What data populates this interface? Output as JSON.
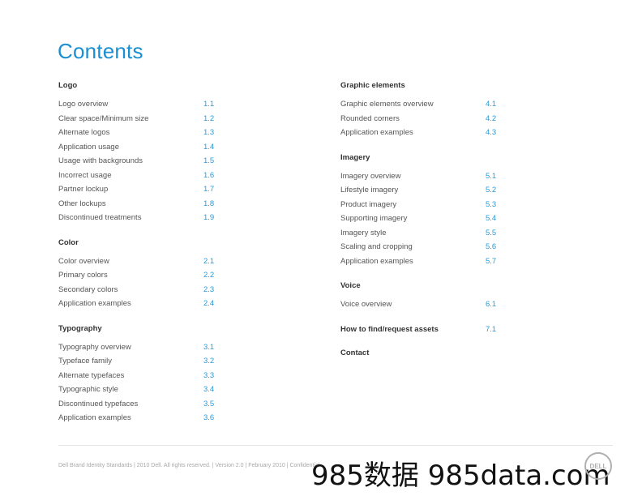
{
  "page": {
    "title": "Contents",
    "accent_color": "#1a8fd1",
    "number_color": "#2a9ad8"
  },
  "left_column": [
    {
      "heading": "Logo",
      "items": [
        {
          "label": "Logo overview",
          "num": "1.1"
        },
        {
          "label": "Clear space/Minimum size",
          "num": "1.2"
        },
        {
          "label": "Alternate logos",
          "num": "1.3"
        },
        {
          "label": "Application usage",
          "num": "1.4"
        },
        {
          "label": "Usage with backgrounds",
          "num": "1.5"
        },
        {
          "label": "Incorrect usage",
          "num": "1.6"
        },
        {
          "label": "Partner lockup",
          "num": "1.7"
        },
        {
          "label": "Other lockups",
          "num": "1.8"
        },
        {
          "label": "Discontinued treatments",
          "num": "1.9"
        }
      ]
    },
    {
      "heading": "Color",
      "items": [
        {
          "label": "Color overview",
          "num": "2.1"
        },
        {
          "label": "Primary colors",
          "num": "2.2"
        },
        {
          "label": "Secondary colors",
          "num": "2.3"
        },
        {
          "label": "Application examples",
          "num": "2.4"
        }
      ]
    },
    {
      "heading": "Typography",
      "items": [
        {
          "label": "Typography overview",
          "num": "3.1"
        },
        {
          "label": "Typeface family",
          "num": "3.2"
        },
        {
          "label": "Alternate typefaces",
          "num": "3.3"
        },
        {
          "label": "Typographic style",
          "num": "3.4"
        },
        {
          "label": "Discontinued typefaces",
          "num": "3.5"
        },
        {
          "label": "Application examples",
          "num": "3.6"
        }
      ]
    }
  ],
  "right_column": [
    {
      "heading": "Graphic elements",
      "items": [
        {
          "label": "Graphic elements overview",
          "num": "4.1"
        },
        {
          "label": "Rounded corners",
          "num": "4.2"
        },
        {
          "label": "Application examples",
          "num": "4.3"
        }
      ]
    },
    {
      "heading": "Imagery",
      "items": [
        {
          "label": "Imagery overview",
          "num": "5.1"
        },
        {
          "label": "Lifestyle imagery",
          "num": "5.2"
        },
        {
          "label": "Product imagery",
          "num": "5.3"
        },
        {
          "label": "Supporting imagery",
          "num": "5.4"
        },
        {
          "label": "Imagery style",
          "num": "5.5"
        },
        {
          "label": "Scaling and cropping",
          "num": "5.6"
        },
        {
          "label": "Application examples",
          "num": "5.7"
        }
      ]
    },
    {
      "heading": "Voice",
      "items": [
        {
          "label": "Voice overview",
          "num": "6.1"
        }
      ]
    },
    {
      "heading": "How to find/request assets",
      "heading_num": "7.1",
      "items": []
    },
    {
      "heading": "Contact",
      "items": []
    }
  ],
  "footer": {
    "text": "Dell Brand Identity Standards  |  2010 Dell. All rights reserved.  |  Version 2.0  |  February 2010  |  Confidential",
    "logo_text": "DELL"
  },
  "watermark": "985数据 985data.com"
}
